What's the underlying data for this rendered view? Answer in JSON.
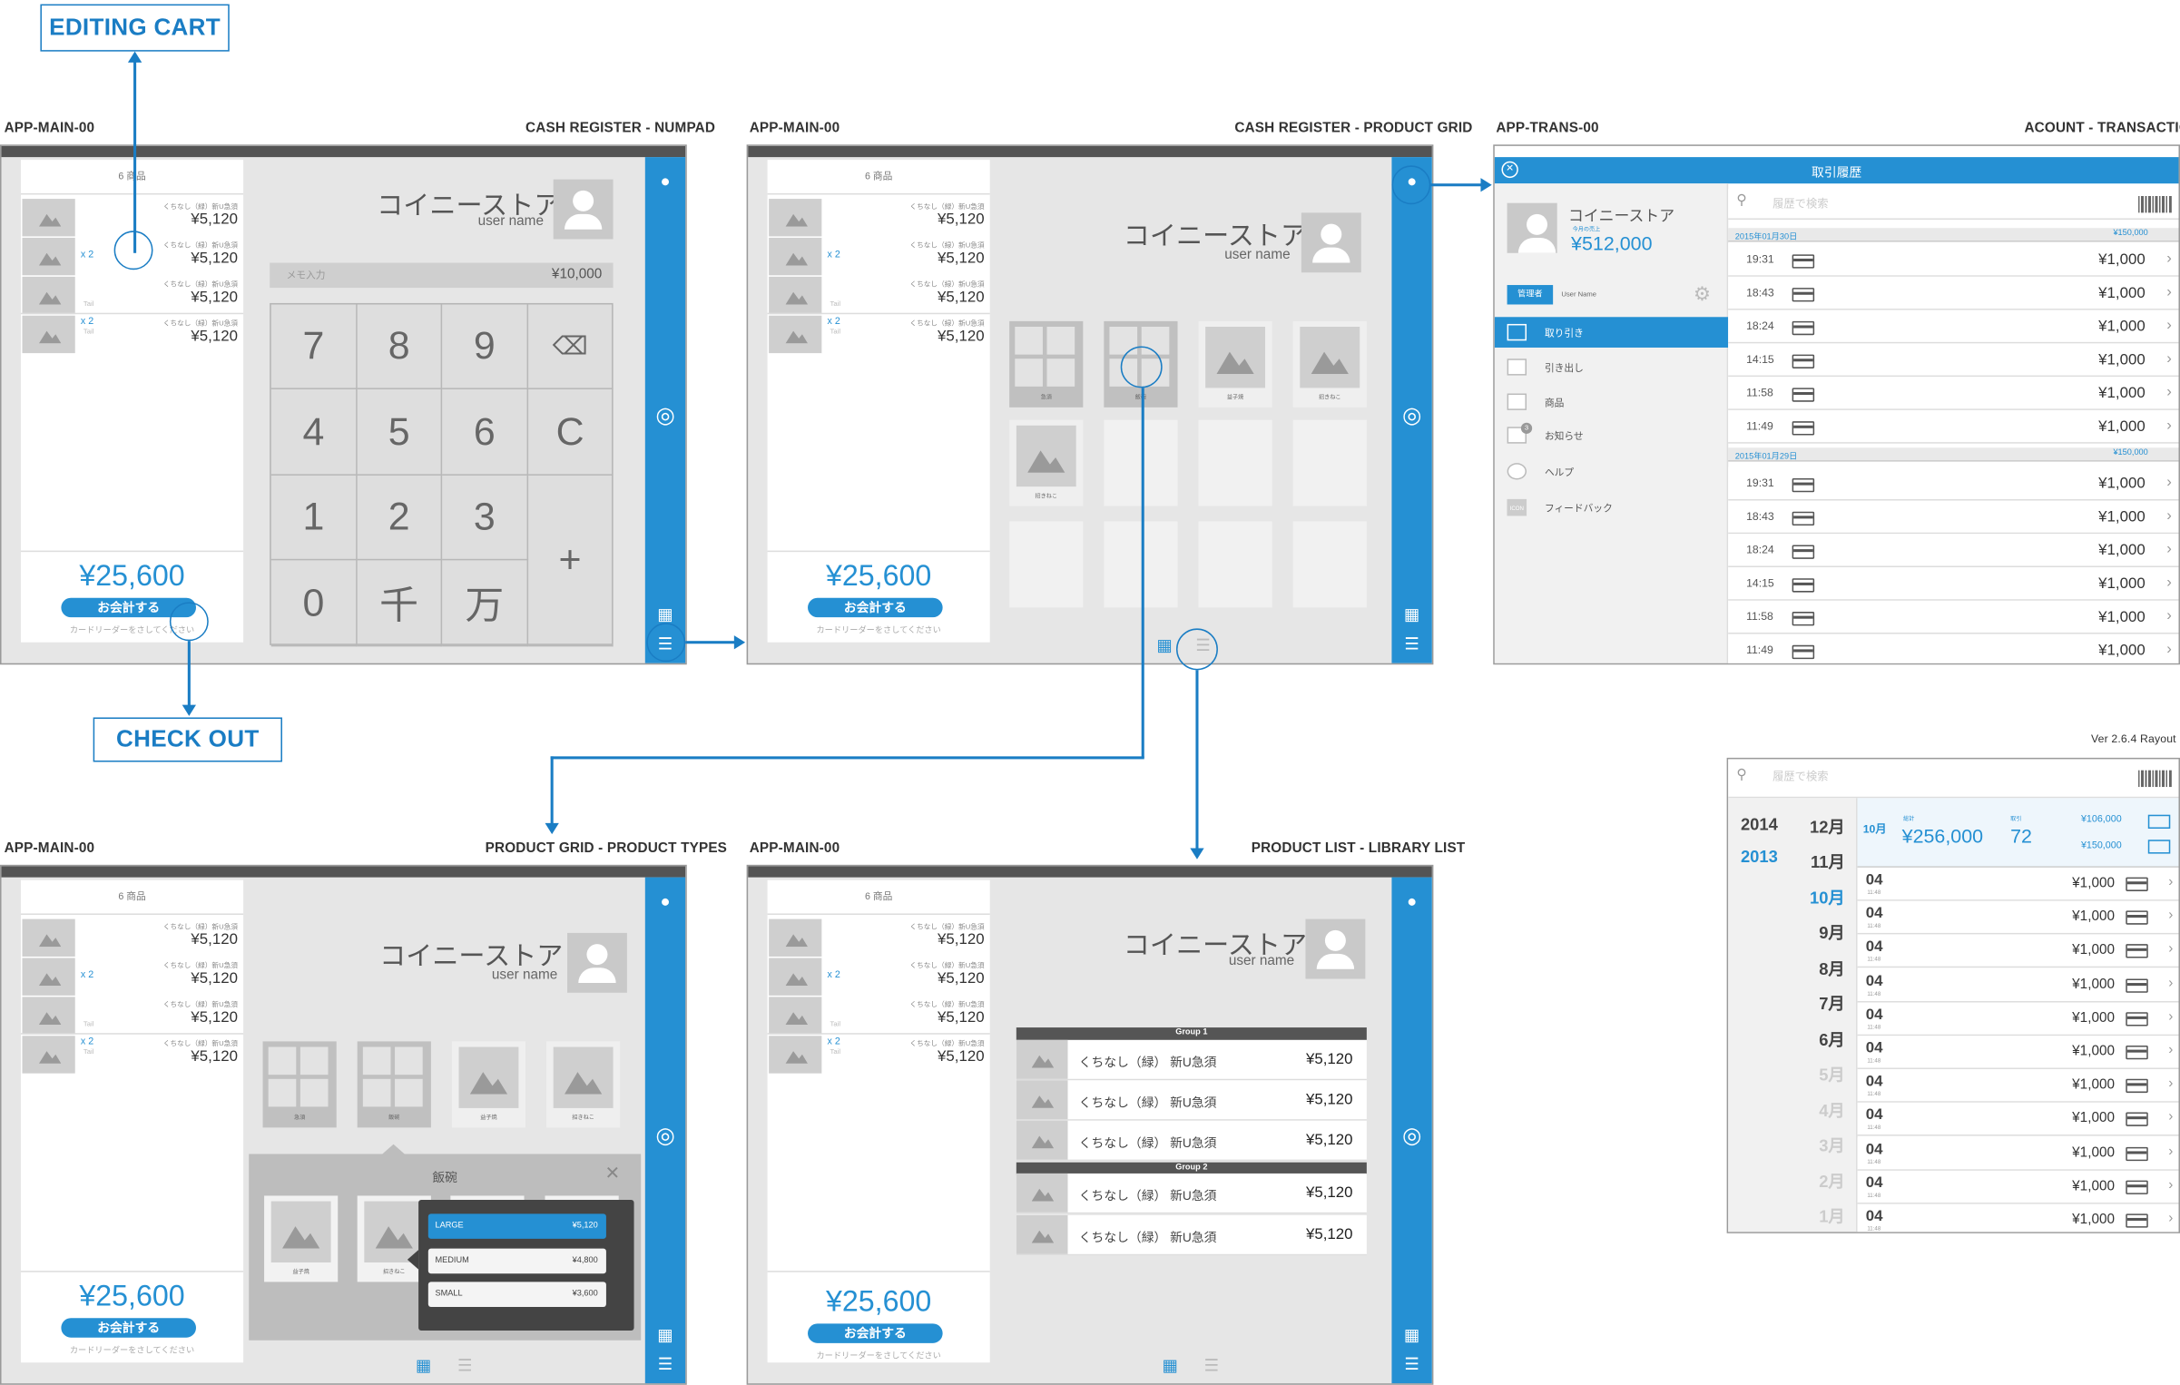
{
  "callouts": {
    "editing_cart": "EDITING CART",
    "check_out": "CHECK OUT"
  },
  "version": "Ver 2.6.4 Rayout",
  "captions": {
    "s1": {
      "id": "APP-MAIN-00",
      "title": "CASH REGISTER - NUMPAD"
    },
    "s2": {
      "id": "APP-MAIN-00",
      "title": "CASH REGISTER - PRODUCT GRID"
    },
    "s3": {
      "id": "APP-TRANS-00",
      "title": "ACOUNT - TRANSACTIONS"
    },
    "s4": {
      "id": "APP-MAIN-00",
      "title": "PRODUCT GRID - PRODUCT TYPES"
    },
    "s5": {
      "id": "APP-MAIN-00",
      "title": "PRODUCT LIST - LIBRARY LIST"
    }
  },
  "cart": {
    "count": "6 商品",
    "item_name": "くちなし（緑）新U急須",
    "price": "¥5,120",
    "qty": "x 2",
    "tail": "Tail",
    "total": "¥25,600",
    "pay": "お会計する",
    "hint": "カードリーダーをさしてください"
  },
  "store": {
    "name": "コイニーストア",
    "user": "user name"
  },
  "numpad": {
    "memo_placeholder": "メモ入力",
    "memo_value": "¥10,000",
    "keys": [
      "7",
      "8",
      "9",
      "⌫",
      "4",
      "5",
      "6",
      "C",
      "1",
      "2",
      "3",
      "+",
      "0",
      "千",
      "万"
    ]
  },
  "grid": {
    "tiles": [
      "急須",
      "飯碗",
      "益子焼",
      "招きねこ",
      "招きねこ"
    ]
  },
  "types": {
    "title": "飯碗",
    "close": "✕",
    "tiles": [
      "益子焼",
      "招きねこ"
    ],
    "options": [
      {
        "name": "LARGE",
        "price": "¥5,120"
      },
      {
        "name": "MEDIUM",
        "price": "¥4,800"
      },
      {
        "name": "SMALL",
        "price": "¥3,600"
      }
    ]
  },
  "library": {
    "groups": [
      {
        "name": "Group 1",
        "rows": [
          "くちなし（緑） 新U急須",
          "くちなし（緑） 新U急須",
          "くちなし（緑） 新U急須"
        ]
      },
      {
        "name": "Group 2",
        "rows": [
          "くちなし（緑） 新U急須",
          "くちなし（緑） 新U急須"
        ]
      }
    ],
    "price": "¥5,120"
  },
  "trans": {
    "header": "取引履歴",
    "store": "コイニーストア",
    "sales_label": "今月の売上",
    "sales": "¥512,000",
    "role": "管理者",
    "user_name": "User Name",
    "menu": [
      "取り引き",
      "引き出し",
      "商品",
      "お知らせ",
      "ヘルプ",
      "フィードバック"
    ],
    "icon_label": "ICON",
    "badge": "3",
    "search": "履歴で検索",
    "days": [
      {
        "date": "2015年01月30日",
        "sum": "¥150,000",
        "times": [
          "19:31",
          "18:43",
          "18:24",
          "14:15",
          "11:58",
          "11:49"
        ]
      },
      {
        "date": "2015年01月29日",
        "sum": "¥150,000",
        "times": [
          "19:31",
          "18:43",
          "18:24",
          "14:15",
          "11:58",
          "11:49"
        ]
      }
    ],
    "amount": "¥1,000"
  },
  "history": {
    "search": "履歴で検索",
    "years": [
      "2014",
      "2013"
    ],
    "months": [
      "12月",
      "11月",
      "10月",
      "9月",
      "8月",
      "7月",
      "6月",
      "5月",
      "4月",
      "3月",
      "2月",
      "1月"
    ],
    "month_sel": "10月",
    "sum_label": "総計",
    "sum": "¥256,000",
    "count_label": "取引",
    "count": "72",
    "cash": "¥106,000",
    "card": "¥150,000",
    "day": "04",
    "time": "11:48",
    "amount": "¥1,000"
  }
}
